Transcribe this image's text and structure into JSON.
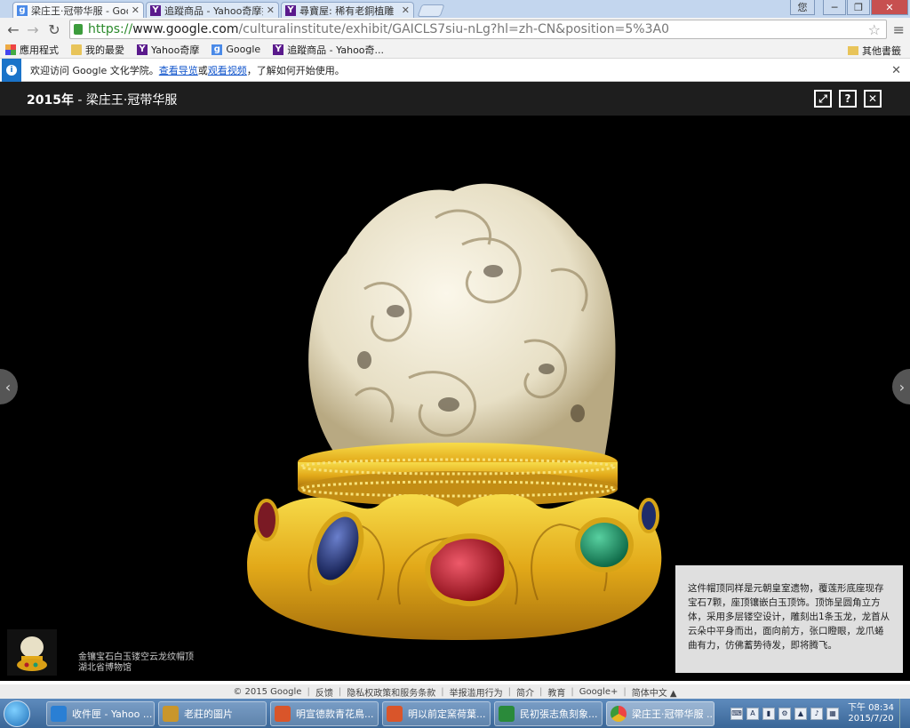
{
  "browser": {
    "tabs": [
      {
        "title": "梁庄王·冠带华服 - Google",
        "favicon": "google-icon",
        "active": true
      },
      {
        "title": "追蹤商品 - Yahoo奇摩拍賣",
        "favicon": "yahoo-icon",
        "active": false
      },
      {
        "title": "尋寶屋: 稀有老銅植雕《鹽",
        "favicon": "yahoo-icon",
        "active": false
      }
    ],
    "url_scheme": "https://",
    "url_host": "www.google.com",
    "url_path": "/culturalinstitute/exhibit/GAICLS7siu-nLg?hl=zh-CN&position=5%3A0",
    "window_user": "您"
  },
  "bookmarks": {
    "items": [
      {
        "label": "應用程式",
        "icon": "apps-grid-icon"
      },
      {
        "label": "我的最愛",
        "icon": "folder-icon"
      },
      {
        "label": "Yahoo奇摩",
        "icon": "yahoo-icon"
      },
      {
        "label": "Google",
        "icon": "google-icon"
      },
      {
        "label": "追蹤商品 - Yahoo奇...",
        "icon": "yahoo-icon"
      }
    ],
    "other": "其他書籤"
  },
  "infobar": {
    "prefix": "欢迎访问 Google 文化学院。",
    "link1": "查看导览",
    "mid": "或",
    "link2": "观看视频",
    "suffix": "，了解如何开始使用。"
  },
  "viewer": {
    "year": "2015年",
    "title": " - 梁庄王·冠带华服",
    "description": "这件帽顶同样是元朝皇室遗物，覆莲形底座现存宝石7颗，座顶镶嵌白玉顶饰。顶饰呈圆角立方体，采用多层镂空设计，雕刻出1条玉龙，龙首从云朵中平身而出，面向前方，张口瞪眼，龙爪蜷曲有力，仿佛蓄势待发，即将腾飞。",
    "caption_line1": "金镶宝石白玉镂空云龙纹帽顶",
    "caption_line2": "湖北省博物馆"
  },
  "footer": {
    "items": [
      "© 2015 Google",
      "反馈",
      "隐私权政策和服务条款",
      "举报滥用行为",
      "简介",
      "教育",
      "Google+",
      "简体中文 ▲"
    ]
  },
  "taskbar": {
    "tasks": [
      {
        "label": "收件匣 - Yahoo ...",
        "color": "#2a7fd4"
      },
      {
        "label": "老莊的圖片",
        "color": "#c9962c"
      },
      {
        "label": "明宣德款青花鳥...",
        "color": "#d9552a"
      },
      {
        "label": "明以前定窯荷葉...",
        "color": "#d9552a"
      },
      {
        "label": "民初張志魚刻象...",
        "color": "#2a8a3a"
      },
      {
        "label": "梁庄王·冠带华服 ...",
        "color": "#e8b623"
      }
    ],
    "clock_period_time": "下午 08:34",
    "clock_date": "2015/7/20"
  },
  "colors": {
    "gold": "#e6b51a",
    "jade": "#efe8d3",
    "ruby": "#c01b2a",
    "sapphire": "#23357a",
    "turquoise": "#1d9a6e"
  }
}
